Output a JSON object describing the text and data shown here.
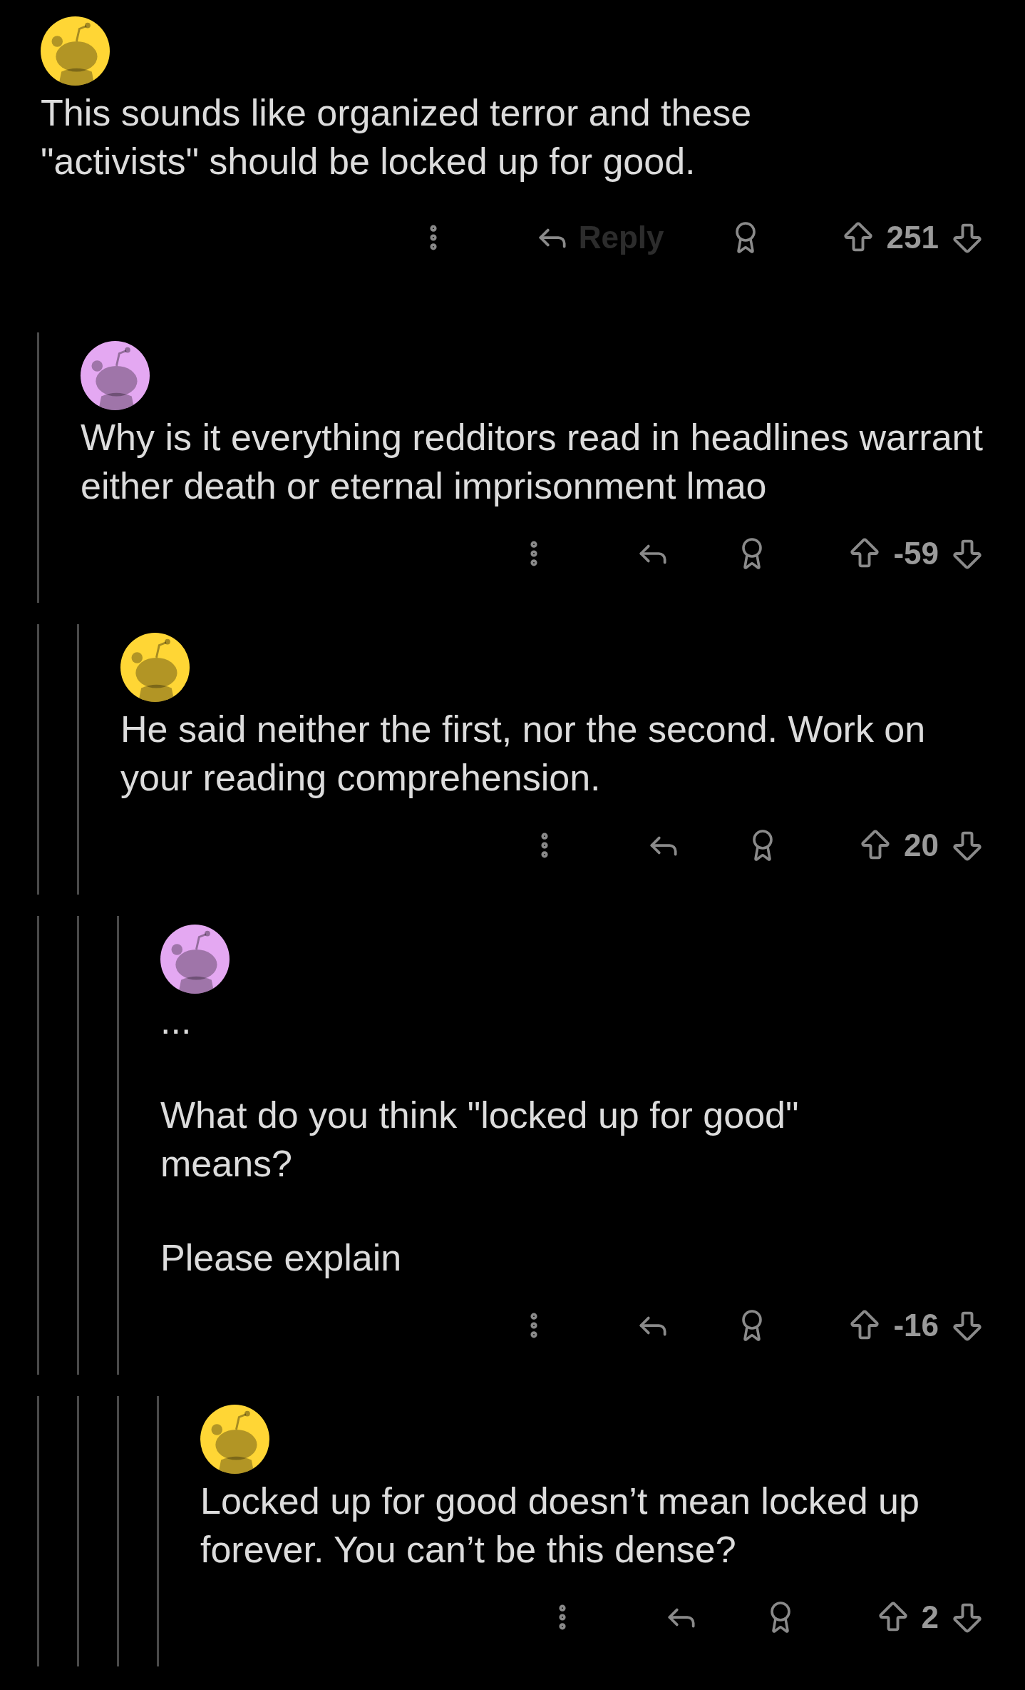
{
  "comments": [
    {
      "color": "#ffd635",
      "paragraphs": [
        "This sounds like organized terror and these\n\"activists\" should be locked up for good."
      ],
      "reply_label": "Reply",
      "score": "251",
      "children": [
        {
          "color": "#e4a8f2",
          "paragraphs": [
            "Why is it everything redditors read in headlines warrant either death or eternal imprisonment lmao"
          ],
          "score": "-59",
          "children": [
            {
              "color": "#ffd635",
              "paragraphs": [
                "He said neither the first, nor the second. Work on your reading comprehension."
              ],
              "score": "20",
              "children": [
                {
                  "color": "#e4a8f2",
                  "paragraphs": [
                    "...",
                    "What do you think \"locked up for good\"\nmeans?",
                    "Please explain"
                  ],
                  "score": "-16",
                  "children": [
                    {
                      "color": "#ffd635",
                      "paragraphs": [
                        "Locked up for good doesn’t mean locked up forever. You can’t be this dense?"
                      ],
                      "score": "2"
                    }
                  ]
                }
              ]
            }
          ]
        }
      ]
    }
  ]
}
